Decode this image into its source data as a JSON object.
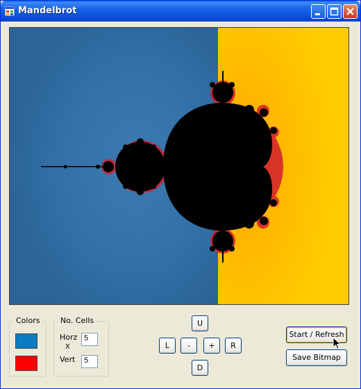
{
  "window": {
    "title": "Mandelbrot"
  },
  "colors_group": {
    "caption": "Colors",
    "swatch1": "#0A7BC2",
    "swatch2": "#FF0000"
  },
  "cells_group": {
    "caption": "No. Cells",
    "horz_label": "Horz",
    "times_symbol": "X",
    "vert_label": "Vert",
    "horz_value": "5",
    "vert_value": "5"
  },
  "navigation": {
    "up": "U",
    "left": "L",
    "zoom_out": "-",
    "zoom_in": "+",
    "right": "R",
    "down": "D"
  },
  "actions": {
    "start_refresh": "Start / Refresh",
    "save_bitmap": "Save Bitmap"
  },
  "fractal_colors": {
    "left_background": "#2E6A9E",
    "right_background": "#FFC400",
    "set_color": "#000000",
    "edge_color": "#D21E2E"
  }
}
